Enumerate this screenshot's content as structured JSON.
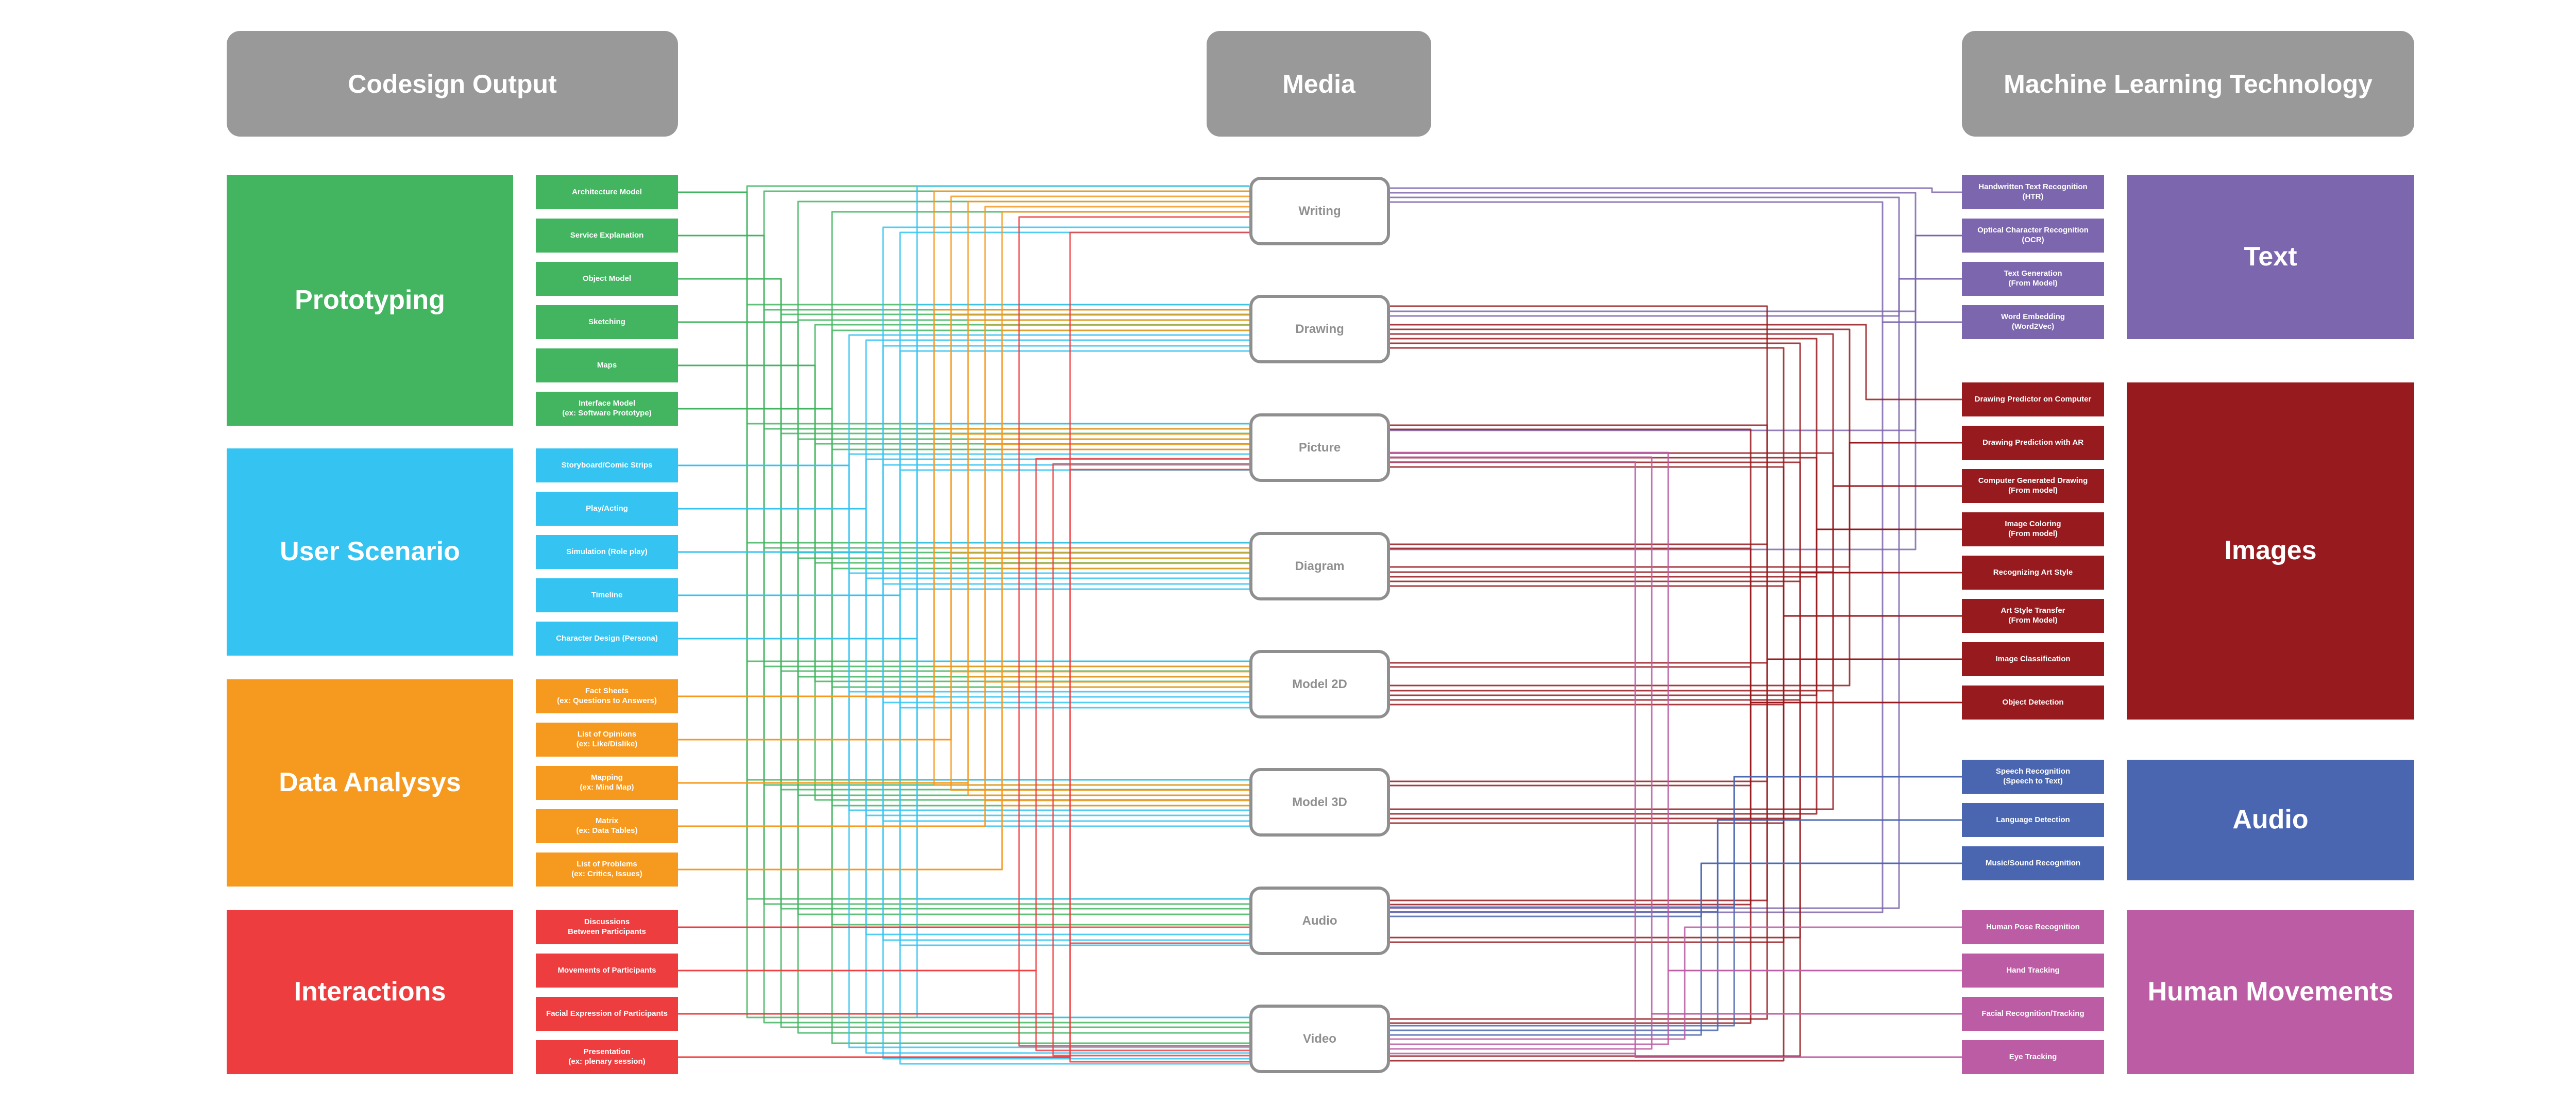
{
  "headers": {
    "codesign_output": "Codesign Output",
    "media": "Media",
    "ml_technology": "Machine Learning Technology"
  },
  "colors": {
    "header": "#999999",
    "media_border": "#8f8f8f",
    "prototyping": "#43b560",
    "user_scenario": "#35c3f1",
    "data_analysis": "#f6991f",
    "interactions": "#ee3d3f",
    "text": "#7c66ae",
    "images": "#961a1e",
    "audio": "#4a66b0",
    "human_movements": "#bb5ca4"
  },
  "codesign_groups": [
    {
      "label": "Prototyping",
      "color": "#43b560",
      "items": [
        "Architecture Model",
        "Service Explanation",
        "Object Model",
        "Sketching",
        "Maps",
        "Interface Model\n(ex: Software Prototype)"
      ]
    },
    {
      "label": "User Scenario",
      "color": "#35c3f1",
      "items": [
        "Storyboard/Comic Strips",
        "Play/Acting",
        "Simulation (Role play)",
        "Timeline",
        "Character Design (Persona)"
      ]
    },
    {
      "label": "Data Analysys",
      "color": "#f6991f",
      "items": [
        "Fact Sheets\n(ex: Questions to Answers)",
        "List of Opinions\n(ex: Like/Dislike)",
        "Mapping\n(ex: Mind Map)",
        "Matrix\n(ex: Data Tables)",
        "List of Problems\n(ex: Critics, Issues)"
      ]
    },
    {
      "label": "Interactions",
      "color": "#ee3d3f",
      "items": [
        "Discussions\nBetween Participants",
        "Movements of Participants",
        "Facial Expression of Participants",
        "Presentation\n(ex: plenary session)"
      ]
    }
  ],
  "media": [
    "Writing",
    "Drawing",
    "Picture",
    "Diagram",
    "Model 2D",
    "Model 3D",
    "Audio",
    "Video"
  ],
  "ml_groups": [
    {
      "label": "Text",
      "color": "#7c66ae",
      "items": [
        "Handwritten Text Recognition\n(HTR)",
        "Optical Character Recognition\n(OCR)",
        "Text Generation\n(From Model)",
        "Word Embedding\n(Word2Vec)"
      ]
    },
    {
      "label": "Images",
      "color": "#961a1e",
      "items": [
        "Drawing Predictor on Computer",
        "Drawing Prediction with AR",
        "Computer Generated Drawing\n(From model)",
        "Image Coloring\n(From model)",
        "Recognizing Art Style",
        "Art Style Transfer\n(From Model)",
        "Image Classification",
        "Object Detection"
      ]
    },
    {
      "label": "Audio",
      "color": "#4a66b0",
      "items": [
        "Speech Recognition\n(Speech to Text)",
        "Language Detection",
        "Music/Sound Recognition"
      ]
    },
    {
      "label": "Human Movements",
      "color": "#bb5ca4",
      "items": [
        "Human Pose Recognition",
        "Hand Tracking",
        "Facial Recognition/Tracking",
        "Eye Tracking"
      ]
    }
  ],
  "left_links": [
    [
      0,
      1,
      2,
      3,
      4,
      5,
      6,
      7
    ],
    [
      0,
      1,
      2,
      3,
      4,
      5,
      6,
      7
    ],
    [
      1,
      2,
      3,
      4,
      5,
      6,
      7
    ],
    [
      0,
      1,
      2,
      3,
      4,
      5,
      6,
      7
    ],
    [
      1,
      2,
      3,
      4,
      5
    ],
    [
      0,
      1,
      2,
      3,
      4,
      5,
      6,
      7
    ],
    [
      1,
      2,
      3,
      4,
      5,
      7
    ],
    [
      1,
      2,
      3,
      4,
      5,
      6,
      7
    ],
    [
      0,
      1,
      2,
      3,
      4,
      5,
      6,
      7
    ],
    [
      0,
      1,
      2,
      3,
      4,
      5,
      6,
      7
    ],
    [
      0,
      1,
      2,
      3,
      4,
      5,
      6,
      7
    ],
    [
      0,
      1,
      2,
      3,
      4,
      5
    ],
    [
      0,
      1,
      2,
      3,
      4,
      5
    ],
    [
      0,
      1,
      2,
      3,
      4,
      5
    ],
    [
      0,
      1,
      2,
      3,
      4,
      5
    ],
    [
      0,
      1,
      2,
      3,
      4,
      5
    ],
    [
      0,
      6,
      7
    ],
    [
      2,
      7
    ],
    [
      2,
      7
    ],
    [
      0,
      2,
      6,
      7
    ]
  ],
  "right_links": [
    [
      0
    ],
    [
      0,
      1,
      2,
      3
    ],
    [
      0,
      1,
      6
    ],
    [
      0,
      6
    ],
    [
      1
    ],
    [
      1,
      3,
      4
    ],
    [
      1,
      2,
      3,
      4,
      5
    ],
    [
      1,
      2,
      3,
      4,
      5
    ],
    [
      1,
      2,
      3,
      4,
      5,
      6,
      7
    ],
    [
      1,
      2,
      3,
      4,
      5,
      6,
      7
    ],
    [
      1,
      2,
      3,
      4,
      5,
      6,
      7
    ],
    [
      2,
      3,
      4,
      5,
      6,
      7
    ],
    [
      6,
      7
    ],
    [
      6,
      7
    ],
    [
      6,
      7
    ],
    [
      7
    ],
    [
      2,
      7
    ],
    [
      2,
      7
    ],
    [
      2,
      7
    ]
  ]
}
